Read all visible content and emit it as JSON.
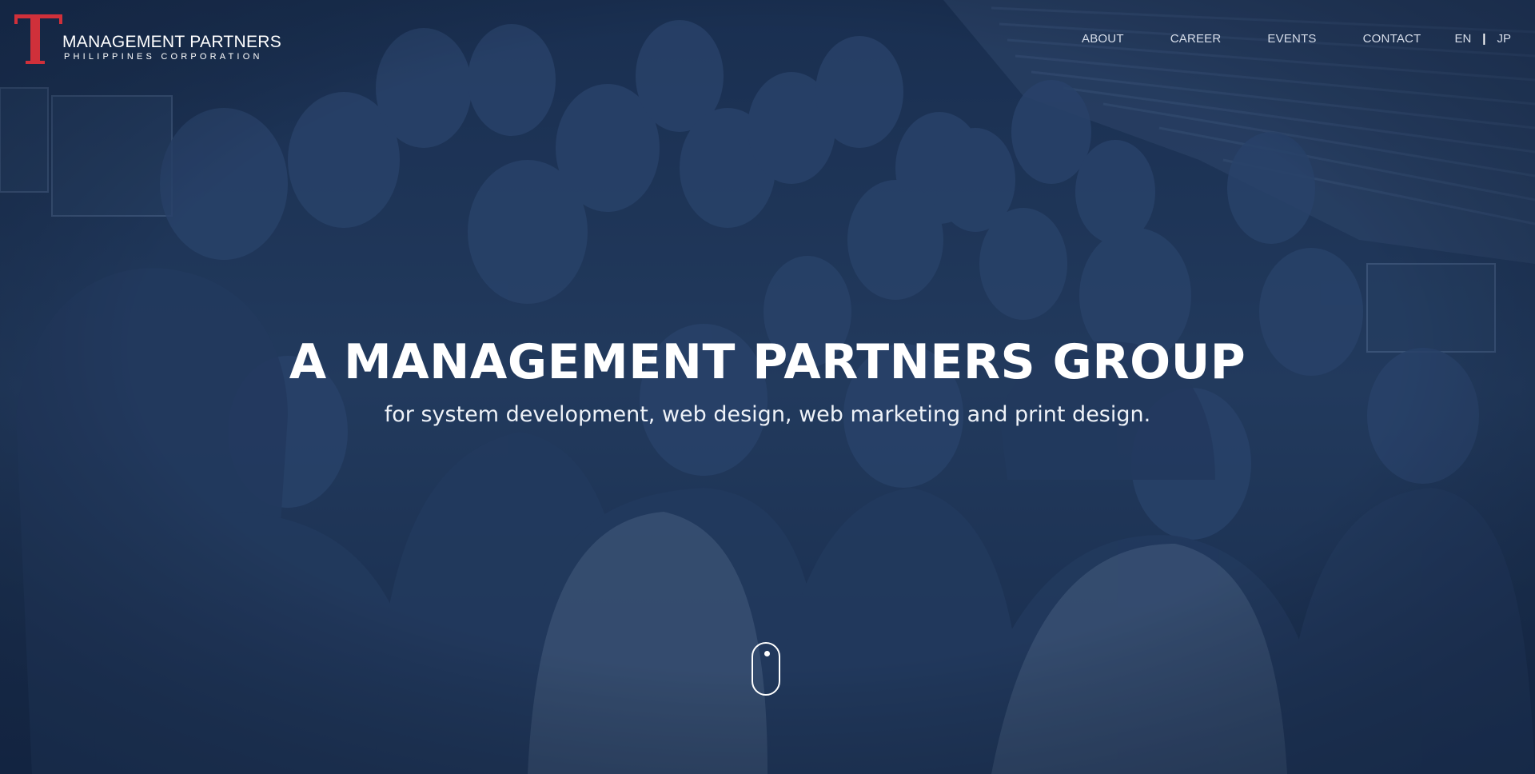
{
  "brand": {
    "logo_letter": "T",
    "name_line1": "MANAGEMENT PARTNERS",
    "name_line2": "PHILIPPINES CORPORATION",
    "accent_color": "#d0303a"
  },
  "nav": {
    "items": [
      {
        "label": "ABOUT"
      },
      {
        "label": "CAREER"
      },
      {
        "label": "EVENTS"
      },
      {
        "label": "CONTACT"
      }
    ],
    "languages": [
      {
        "label": "EN"
      },
      {
        "label": "JP"
      }
    ],
    "language_separator": "|"
  },
  "hero": {
    "title": "A MANAGEMENT PARTNERS GROUP",
    "subtitle": "for system development, web design, web marketing and print design.",
    "overlay_color": "#1f3556",
    "scroll_icon": "mouse-scroll-icon"
  }
}
